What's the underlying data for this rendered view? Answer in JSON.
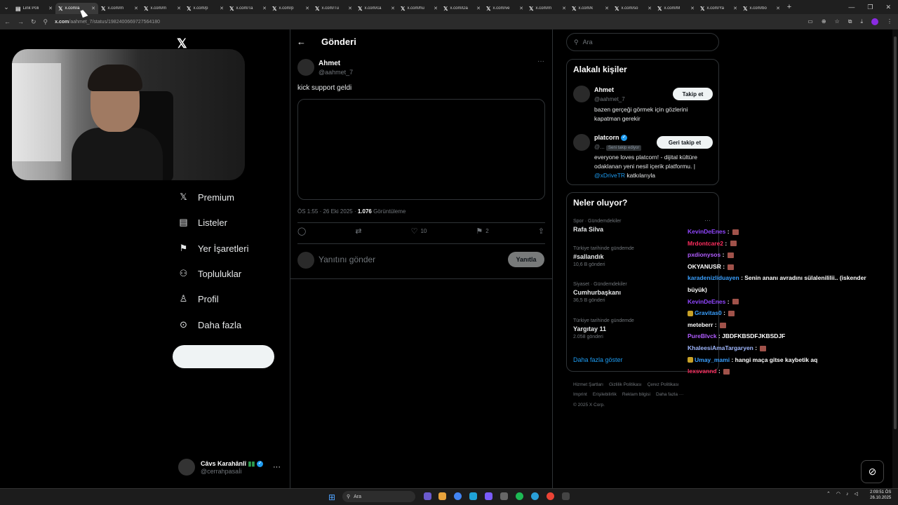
{
  "browser": {
    "tabs": [
      {
        "title": "Link Poli",
        "icon": "doc-icon",
        "active": false
      },
      {
        "title": "x.com/a",
        "icon": "x-icon",
        "active": true
      },
      {
        "title": "x.com/m",
        "icon": "x-icon",
        "active": false
      },
      {
        "title": "x.com/m",
        "icon": "x-icon",
        "active": false
      },
      {
        "title": "x.com/p",
        "icon": "x-icon",
        "active": false
      },
      {
        "title": "x.com/Ta",
        "icon": "x-icon",
        "active": false
      },
      {
        "title": "x.com/p",
        "icon": "x-icon",
        "active": false
      },
      {
        "title": "x.com/Tu",
        "icon": "x-icon",
        "active": false
      },
      {
        "title": "x.com/ca",
        "icon": "x-icon",
        "active": false
      },
      {
        "title": "x.com/hu",
        "icon": "x-icon",
        "active": false
      },
      {
        "title": "x.com/Da",
        "icon": "x-icon",
        "active": false
      },
      {
        "title": "x.com/ve",
        "icon": "x-icon",
        "active": false
      },
      {
        "title": "x.com/m",
        "icon": "x-icon",
        "active": false
      },
      {
        "title": "x.com/k",
        "icon": "x-icon",
        "active": false
      },
      {
        "title": "x.com/so",
        "icon": "x-icon",
        "active": false
      },
      {
        "title": "x.com/M",
        "icon": "x-icon",
        "active": false
      },
      {
        "title": "x.com/Ya",
        "icon": "x-icon",
        "active": false
      },
      {
        "title": "x.com/bo",
        "icon": "x-icon",
        "active": false
      }
    ],
    "url_domain": "x.com",
    "url_path": "/aahmet_7/status/1982400669727564180"
  },
  "nav": {
    "items": [
      {
        "label": "Premium",
        "icon": "x-logo-icon",
        "glyph": "𝕏"
      },
      {
        "label": "Listeler",
        "icon": "list-icon",
        "glyph": "▤"
      },
      {
        "label": "Yer İşaretleri",
        "icon": "bookmark-icon",
        "glyph": "⚑"
      },
      {
        "label": "Topluluklar",
        "icon": "communities-icon",
        "glyph": "⚇"
      },
      {
        "label": "Profil",
        "icon": "profile-icon",
        "glyph": "♙"
      },
      {
        "label": "Daha fazla",
        "icon": "more-circle-icon",
        "glyph": "⊙"
      }
    ],
    "account": {
      "name": "Câvs Karahânlî",
      "handle": "@cerrahpasaİi"
    }
  },
  "post": {
    "header_title": "Gönderi",
    "author_name": "Ahmet",
    "author_handle": "@aahmet_7",
    "text": "kick support geldi",
    "time": "ÖS 1:55 · 26 Eki 2025 · ",
    "views": "1.076",
    "views_label": " Görüntüleme",
    "likes": "10",
    "bookmarks": "2",
    "reply_placeholder": "Yanıtını gönder",
    "reply_button": "Yanıtla"
  },
  "sidebar": {
    "search_placeholder": "Ara",
    "related_title": "Alakalı kişiler",
    "people": [
      {
        "name": "Ahmet",
        "handle": "@aahmet_7",
        "bio": "bazen gerçeği görmek için gözlerini kapatman gerekir",
        "button": "Takip et"
      },
      {
        "name": "platcorn",
        "handle": "@...",
        "follows_you": "Seni takip ediyor",
        "bio": "everyone loves platcorn! - dijital kültüre odaklanan yeni nesil içerik platformu. | ",
        "bio_link": "@xDriveTR",
        "bio_end": " katkılarıyla",
        "button": "Geri takip et"
      }
    ],
    "trends_title": "Neler oluyor?",
    "trends": [
      {
        "context": "Spor · Gündemdekiler",
        "name": "Rafa Silva",
        "count": ""
      },
      {
        "context": "Türkiye tarihinde gündemde",
        "name": "#sallandık",
        "count": "10,6 B gönderi"
      },
      {
        "context": "Siyaset · Gündemdekiler",
        "name": "Cumhurbaşkanı",
        "count": "36,5 B gönderi"
      },
      {
        "context": "Türkiye tarihinde gündemde",
        "name": "Yargıtay 11",
        "count": "2.058 gönderi"
      }
    ],
    "show_more": "Daha fazla göster",
    "footer": [
      "Hizmet Şartları",
      "Gizlilik Politikası",
      "Çerez Politikası",
      "Imprint",
      "Erişilebilirlik",
      "Reklam bilgisi",
      "Daha fazla ···",
      "© 2025 X Corp."
    ]
  },
  "chat": [
    {
      "user": "KevinDeEnes",
      "color": "#9146ff",
      "msg": "",
      "emote": true
    },
    {
      "user": "Mrdontcare2",
      "color": "#ff2e5f",
      "msg": "",
      "emote": true
    },
    {
      "user": "pxdionysos",
      "color": "#b15cff",
      "msg": "",
      "emote": true
    },
    {
      "user": "OKYANUSR",
      "color": "#ffffff",
      "msg": "",
      "emote": true
    },
    {
      "user": "karadenizliduayen",
      "color": "#3aa0ff",
      "msg": "Senin ananı avradını sülalenililii.. (iskender büyük)",
      "emote": false
    },
    {
      "user": "KevinDeEnes",
      "color": "#9146ff",
      "msg": "",
      "emote": true
    },
    {
      "user": "Gravitas0",
      "color": "#3aa0ff",
      "msg": "",
      "emote": true,
      "badge": true
    },
    {
      "user": "meteberr",
      "color": "#ffffff",
      "msg": "",
      "emote": true
    },
    {
      "user": "PureBlvck",
      "color": "#b15cff",
      "msg": "JBDFKBSDFJKBSDJF",
      "emote": false
    },
    {
      "user": "KhaleesiAmaTargaryen",
      "color": "#a0b8ff",
      "msg": "",
      "emote": true
    },
    {
      "user": "Umay_mami",
      "color": "#3aa0ff",
      "msg": "hangi maça gitse kaybetik aq",
      "emote": false,
      "badge": true
    },
    {
      "user": "lexsvannd",
      "color": "#ff2e5f",
      "msg": "",
      "emote": true
    }
  ],
  "taskbar": {
    "search": "Ara",
    "time": "2:09:51 ÖS",
    "date": "26.10.2025"
  },
  "colors": {
    "accent": "#1d9bf0",
    "bg": "#000000",
    "border": "#2f3336"
  }
}
